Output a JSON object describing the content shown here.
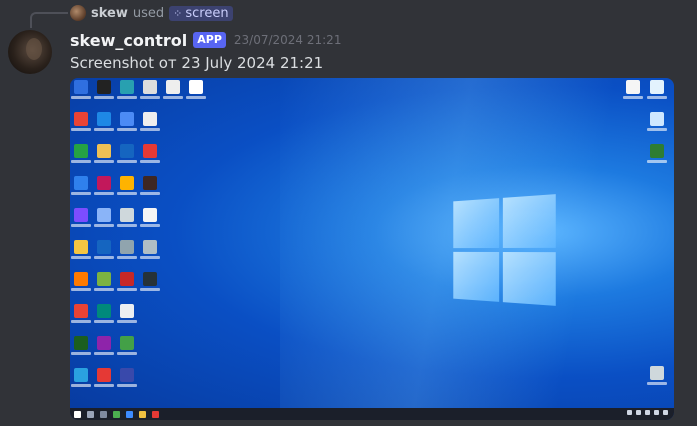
{
  "reply": {
    "user": "skew",
    "used": "used",
    "command": "screen",
    "command_icon": "grid-icon"
  },
  "message": {
    "username": "skew_control",
    "badge": "APP",
    "timestamp": "23/07/2024 21:21",
    "text": "Screenshot от 23 July 2024 21:21"
  },
  "colors": {
    "background": "#313338",
    "badge": "#5865f2",
    "desktop_blue": "#0a4fc4"
  }
}
